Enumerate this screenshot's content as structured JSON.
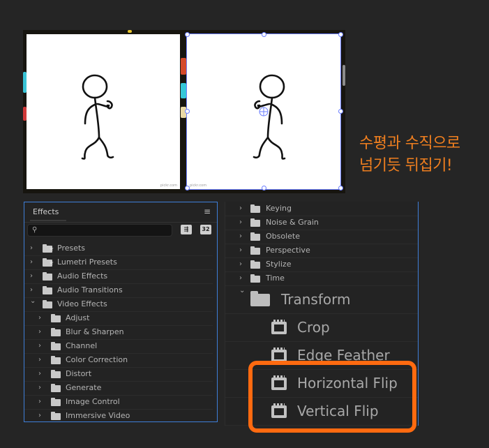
{
  "caption": {
    "line1": "수평과 수직으로",
    "line2": "넘기듯 뒤집기!"
  },
  "preview": {
    "left_credit": "pickr.com",
    "right_credit": "pickr.com"
  },
  "effects_panel": {
    "title": "Effects",
    "menu_icon": "hamburger-icon",
    "search_placeholder": "",
    "toolbar": {
      "accel_label": "",
      "bit_label": "32"
    },
    "items": [
      {
        "label": "Presets",
        "icon": "star-folder-icon",
        "expanded": false,
        "level": 0
      },
      {
        "label": "Lumetri Presets",
        "icon": "star-folder-icon",
        "expanded": false,
        "level": 0
      },
      {
        "label": "Audio Effects",
        "icon": "folder-icon",
        "expanded": false,
        "level": 0
      },
      {
        "label": "Audio Transitions",
        "icon": "folder-icon",
        "expanded": false,
        "level": 0
      },
      {
        "label": "Video Effects",
        "icon": "folder-icon",
        "expanded": true,
        "level": 0
      },
      {
        "label": "Adjust",
        "icon": "folder-icon",
        "expanded": false,
        "level": 1
      },
      {
        "label": "Blur & Sharpen",
        "icon": "folder-icon",
        "expanded": false,
        "level": 1
      },
      {
        "label": "Channel",
        "icon": "folder-icon",
        "expanded": false,
        "level": 1
      },
      {
        "label": "Color Correction",
        "icon": "folder-icon",
        "expanded": false,
        "level": 1
      },
      {
        "label": "Distort",
        "icon": "folder-icon",
        "expanded": false,
        "level": 1
      },
      {
        "label": "Generate",
        "icon": "folder-icon",
        "expanded": false,
        "level": 1
      },
      {
        "label": "Image Control",
        "icon": "folder-icon",
        "expanded": false,
        "level": 1
      },
      {
        "label": "Immersive Video",
        "icon": "folder-icon",
        "expanded": false,
        "level": 1
      }
    ]
  },
  "zoom_panel": {
    "folders": [
      {
        "label": "Keying"
      },
      {
        "label": "Noise & Grain"
      },
      {
        "label": "Obsolete"
      },
      {
        "label": "Perspective"
      },
      {
        "label": "Stylize"
      },
      {
        "label": "Time"
      }
    ],
    "transform": {
      "label": "Transform",
      "expanded": true
    },
    "effects": [
      {
        "label": "Crop"
      },
      {
        "label": "Edge Feather"
      },
      {
        "label": "Horizontal Flip"
      },
      {
        "label": "Vertical Flip"
      }
    ]
  },
  "colors": {
    "accent": "#f07f1f",
    "highlight_border": "#ff6a10",
    "panel_focus": "#3f7fd9"
  }
}
